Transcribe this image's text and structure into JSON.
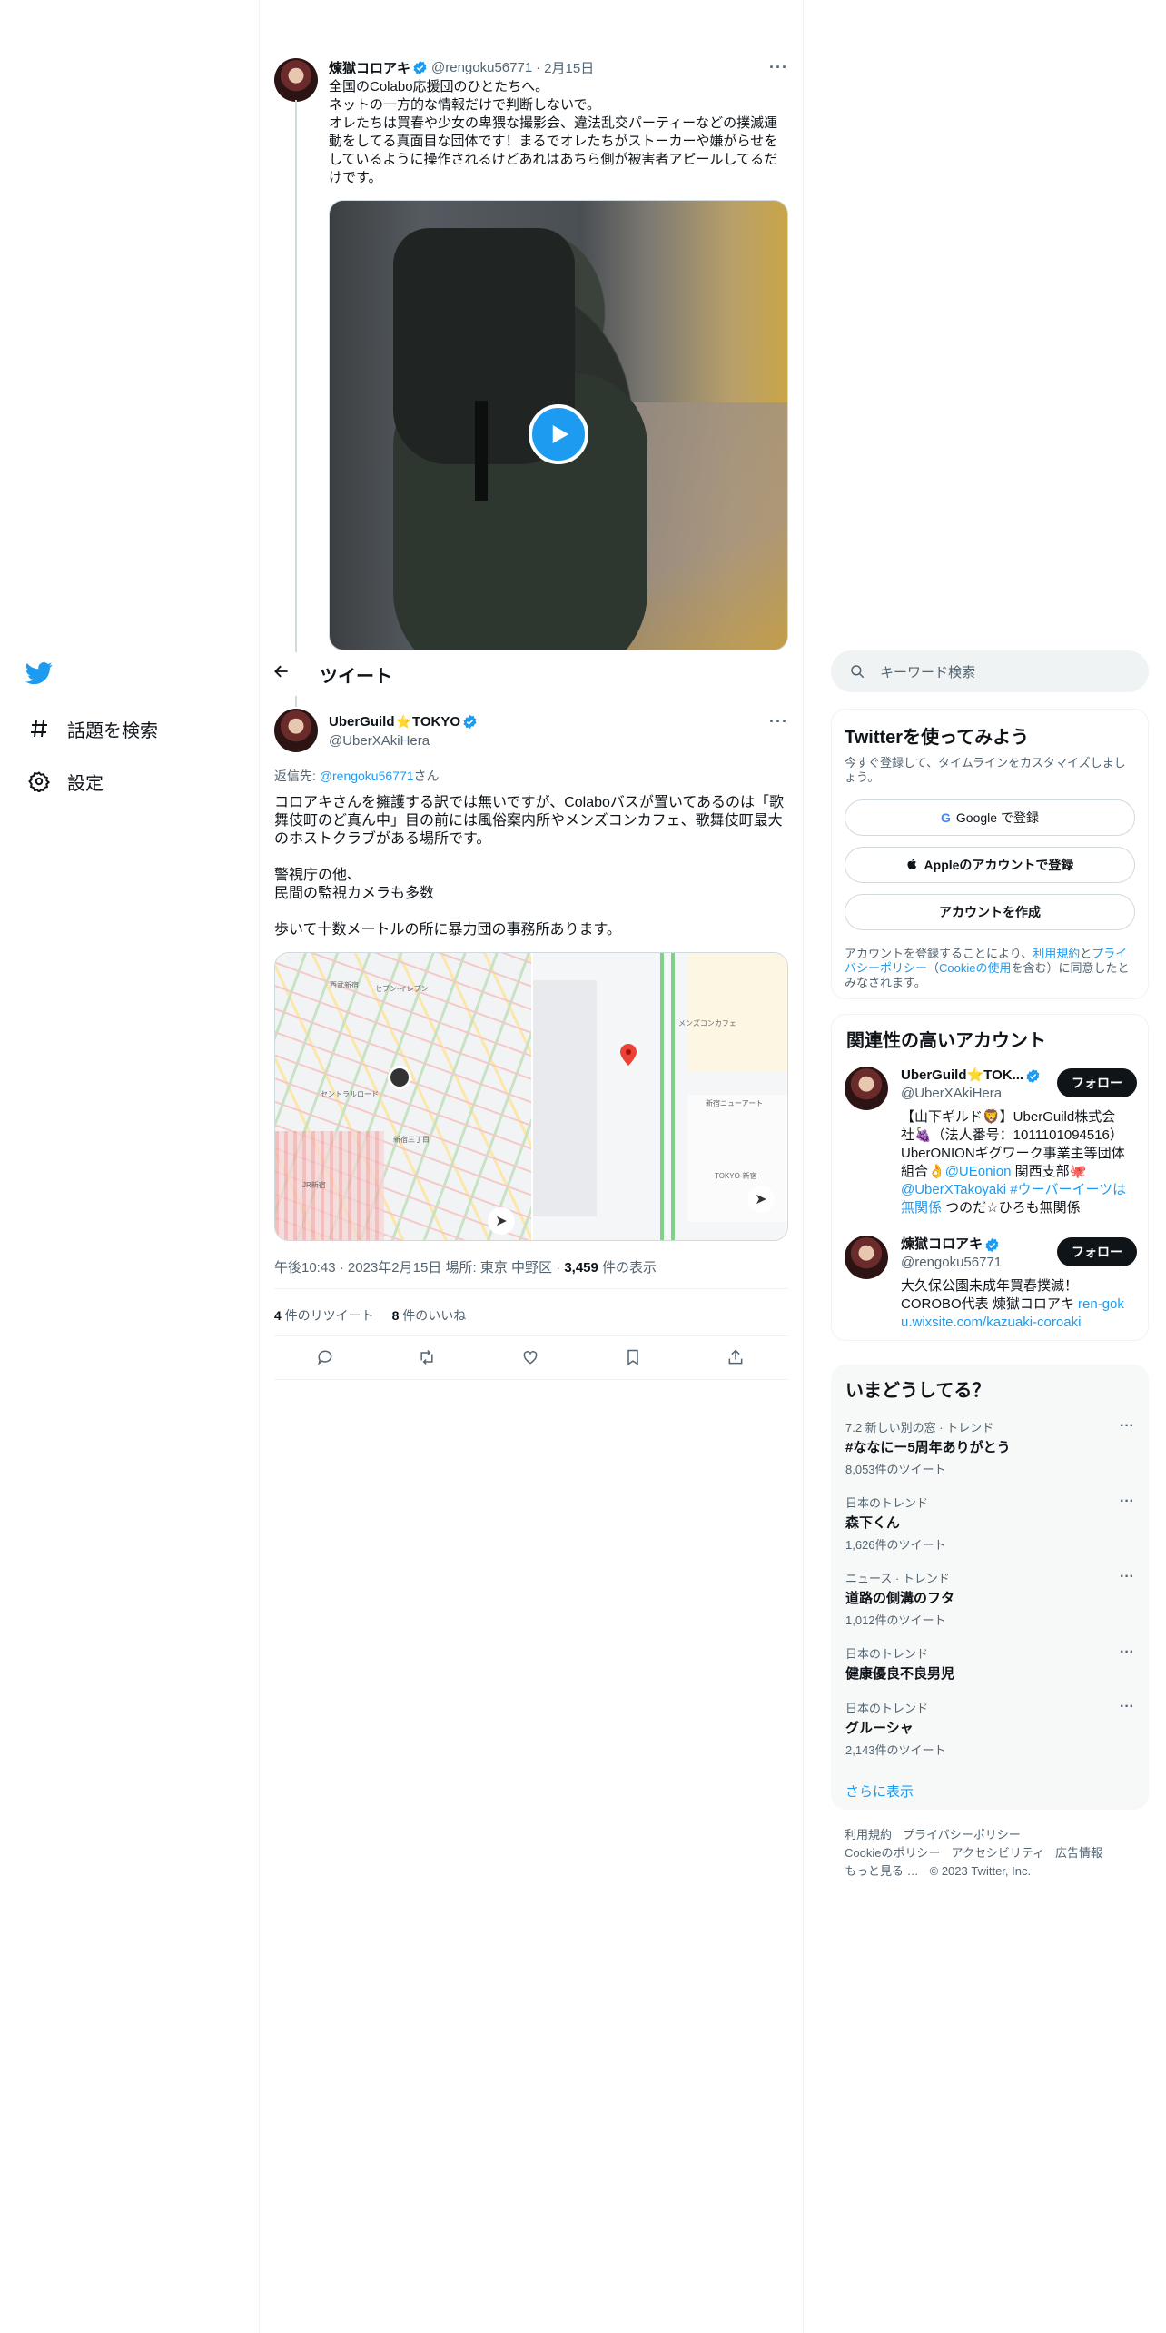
{
  "nav": {
    "items": [
      {
        "label": "話題を検索",
        "icon": "hashtag-icon"
      },
      {
        "label": "設定",
        "icon": "gear-icon"
      }
    ]
  },
  "header": {
    "title": "ツイート"
  },
  "parent_tweet": {
    "name": "煉獄コロアキ",
    "handle": "@rengoku56771",
    "date": "2月15日",
    "text": "全国のColabo応援団のひとたちへ。\nネットの一方的な情報だけで判断しないで。\nオレたちは買春や少女の卑猥な撮影会、違法乱交パーティーなどの撲滅運動をしてる真面目な団体です！まるでオレたちがストーカーや嫌がらせをしているように操作されるけどあれはあちら側が被害者アピールしてるだけです。"
  },
  "main_tweet": {
    "name_a": "UberGuild",
    "name_b": "TOKYO",
    "handle": "@UberXAkiHera",
    "reply_prefix": "返信先: ",
    "reply_to": "@rengoku56771",
    "reply_suffix": "さん",
    "text": "コロアキさんを擁護する訳では無いですが、Colaboバスが置いてあるのは「歌舞伎町のど真ん中」目の前には風俗案内所やメンズコンカフェ、歌舞伎町最大のホストクラブがある場所です。\n\n警視庁の他、\n民間の監視カメラも多数\n\n歩いて十数メートルの所に暴力団の事務所あります。",
    "map_labels": [
      "西武新宿",
      "セブン-イレブン",
      "新宿三丁目",
      "JR新宿",
      "セントラルロード",
      "新宿ニューアート",
      "メンズコンカフェ",
      "TOKYO-新宿"
    ],
    "time": "午後10:43",
    "date": "2023年2月15日",
    "place_prefix": "場所: ",
    "place": "東京 中野区",
    "views": "3,459",
    "views_suffix": " 件の表示",
    "retweets": "4",
    "retweets_label": " 件のリツイート",
    "likes": "8",
    "likes_label": " 件のいいね"
  },
  "search": {
    "placeholder": "キーワード検索"
  },
  "signup": {
    "title": "Twitterを使ってみよう",
    "sub": "今すぐ登録して、タイムラインをカスタマイズしましょう。",
    "google": "Google で登録",
    "apple": "Appleのアカウントで登録",
    "create": "アカウントを作成",
    "legal_1": "アカウントを登録することにより、",
    "legal_terms": "利用規約",
    "legal_2": "と",
    "legal_privacy": "プライバシーポリシー",
    "legal_3": "（",
    "legal_cookie": "Cookieの使用",
    "legal_4": "を含む）に同意したとみなされます。"
  },
  "related": {
    "title": "関連性の高いアカウント",
    "follow_label": "フォロー",
    "accounts": [
      {
        "name": "UberGuild⭐TOK...",
        "handle": "@UberXAkiHera",
        "bio_1": "【山下ギルド🦁】UberGuild株式会社🍇（法人番号：1011101094516）UberONIONギグワーク事業主等団体組合👌",
        "bio_link1": "@UEonion",
        "bio_2": " 関西支部🐙",
        "bio_link2": "@UberXTakoyaki",
        "bio_link3": " #ウーバーイーツは無関係",
        "bio_3": " つのだ☆ひろも無関係"
      },
      {
        "name": "煉獄コロアキ",
        "handle": "@rengoku56771",
        "bio_1": "大久保公園未成年買春撲滅！COROBO代表 煉獄コロアキ ",
        "bio_link1": "ren-goku.wixsite.com/kazuaki-coroaki"
      }
    ]
  },
  "trends": {
    "title": "いまどうしてる？",
    "items": [
      {
        "ctx": "7.2 新しい別の窓 · トレンド",
        "t": "#ななにー5周年ありがとう",
        "c": "8,053件のツイート"
      },
      {
        "ctx": "日本のトレンド",
        "t": "森下くん",
        "c": "1,626件のツイート"
      },
      {
        "ctx": "ニュース · トレンド",
        "t": "道路の側溝のフタ",
        "c": "1,012件のツイート"
      },
      {
        "ctx": "日本のトレンド",
        "t": "健康優良不良男児",
        "c": ""
      },
      {
        "ctx": "日本のトレンド",
        "t": "グルーシャ",
        "c": "2,143件のツイート"
      }
    ],
    "show_more": "さらに表示"
  },
  "footer": {
    "items": [
      "利用規約",
      "プライバシーポリシー",
      "Cookieのポリシー",
      "アクセシビリティ",
      "広告情報",
      "もっと見る …",
      "© 2023 Twitter, Inc."
    ]
  }
}
